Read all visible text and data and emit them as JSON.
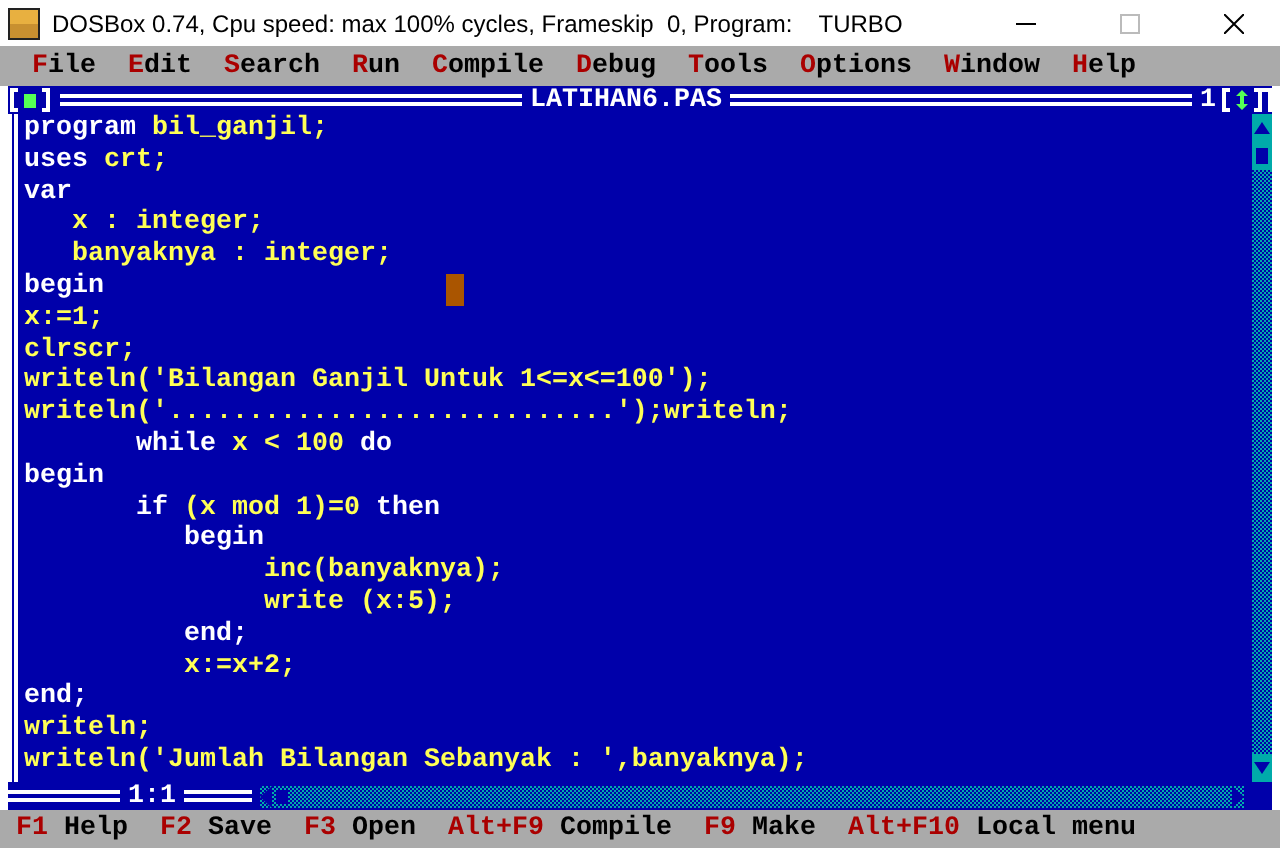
{
  "window": {
    "title": "DOSBox 0.74, Cpu speed: max 100% cycles, Frameskip  0, Program:    TURBO"
  },
  "menu": [
    "File",
    "Edit",
    "Search",
    "Run",
    "Compile",
    "Debug",
    "Tools",
    "Options",
    "Window",
    "Help"
  ],
  "editor": {
    "title": "LATIHAN6.PAS",
    "window_number": "1",
    "position": "1:1",
    "lines": [
      [
        {
          "kind": "keyword",
          "text": "program"
        },
        {
          "kind": "text",
          "text": " bil_ganjil;"
        }
      ],
      [
        {
          "kind": "keyword",
          "text": "uses"
        },
        {
          "kind": "text",
          "text": " crt;"
        }
      ],
      [
        {
          "kind": "keyword",
          "text": "var"
        }
      ],
      [
        {
          "kind": "text",
          "text": "   x : integer;"
        }
      ],
      [
        {
          "kind": "text",
          "text": "   banyaknya : integer;"
        }
      ],
      [
        {
          "kind": "keyword",
          "text": "begin"
        }
      ],
      [
        {
          "kind": "text",
          "text": "x:=1;"
        }
      ],
      [
        {
          "kind": "text",
          "text": "clrscr;"
        }
      ],
      [
        {
          "kind": "text",
          "text": "writeln('Bilangan Ganjil Untuk 1<=x<=100');"
        }
      ],
      [
        {
          "kind": "text",
          "text": "writeln('............................');writeln;"
        }
      ],
      [
        {
          "kind": "keyword",
          "text": "       while"
        },
        {
          "kind": "text",
          "text": " x < 100 "
        },
        {
          "kind": "keyword",
          "text": "do"
        }
      ],
      [
        {
          "kind": "keyword",
          "text": "begin"
        }
      ],
      [
        {
          "kind": "keyword",
          "text": "       if"
        },
        {
          "kind": "text",
          "text": " (x mod 1)=0 "
        },
        {
          "kind": "keyword",
          "text": "then"
        }
      ],
      [
        {
          "kind": "keyword",
          "text": "          begin"
        }
      ],
      [
        {
          "kind": "text",
          "text": "               inc(banyaknya);"
        }
      ],
      [
        {
          "kind": "text",
          "text": "               write (x:5);"
        }
      ],
      [
        {
          "kind": "keyword",
          "text": "          end;"
        }
      ],
      [
        {
          "kind": "text",
          "text": "          x:=x+2;"
        }
      ],
      [
        {
          "kind": "keyword",
          "text": "end;"
        }
      ],
      [
        {
          "kind": "text",
          "text": "writeln;"
        }
      ],
      [
        {
          "kind": "text",
          "text": "writeln('Jumlah Bilangan Sebanyak : ',banyaknya);"
        }
      ]
    ]
  },
  "status_bar": [
    {
      "key": "F1",
      "label": "Help"
    },
    {
      "key": "F2",
      "label": "Save"
    },
    {
      "key": "F3",
      "label": "Open"
    },
    {
      "key": "Alt+F9",
      "label": "Compile"
    },
    {
      "key": "F9",
      "label": "Make"
    },
    {
      "key": "Alt+F10",
      "label": "Local menu"
    }
  ]
}
